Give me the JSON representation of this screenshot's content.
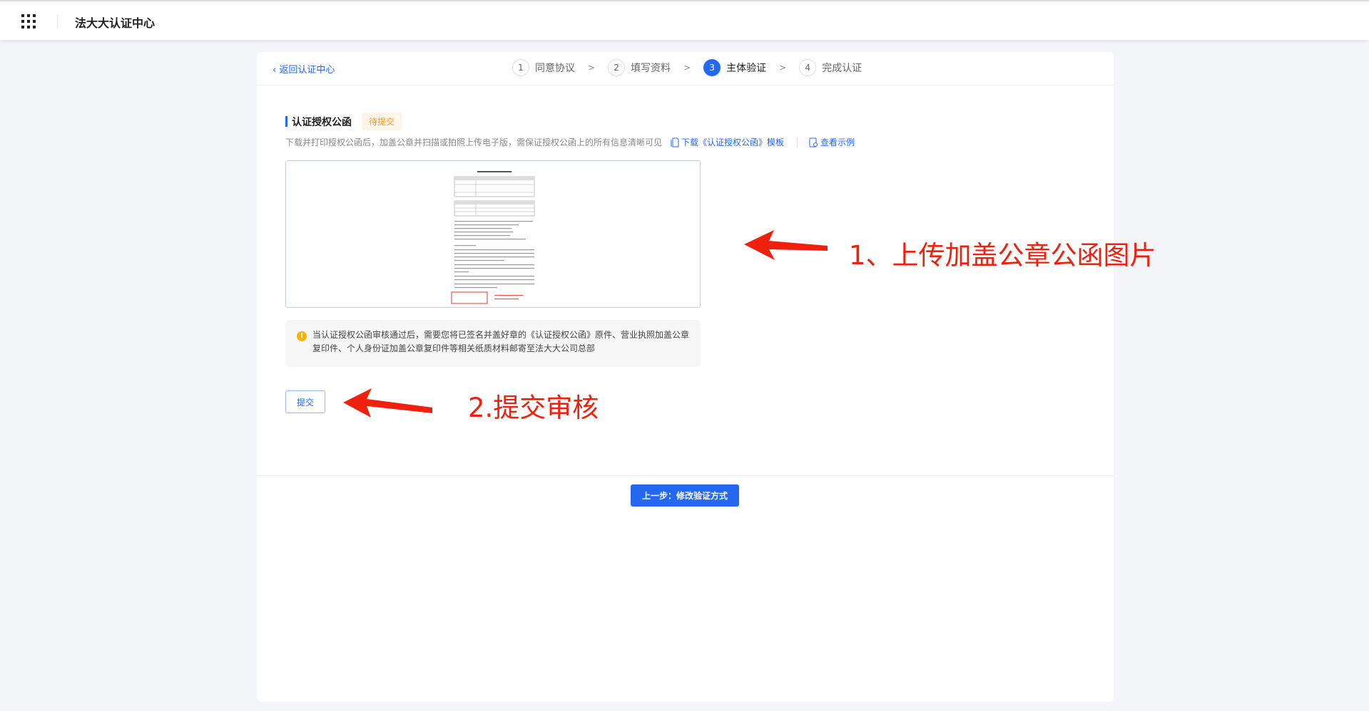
{
  "header": {
    "title": "法大大认证中心",
    "apps_icon": "grid-icon"
  },
  "nav": {
    "back_label": "返回认证中心"
  },
  "steps": [
    {
      "num": "1",
      "label": "同意协议",
      "state": "done"
    },
    {
      "num": "2",
      "label": "填写资料",
      "state": "done"
    },
    {
      "num": "3",
      "label": "主体验证",
      "state": "active"
    },
    {
      "num": "4",
      "label": "完成认证",
      "state": "pending"
    }
  ],
  "section": {
    "title": "认证授权公函",
    "status": "待提交",
    "description": "下载并打印授权公函后，加盖公章并扫描或拍照上传电子版，需保证授权公函上的所有信息清晰可见",
    "download_link": "下载《认证授权公函》模板",
    "example_link": "查看示例"
  },
  "notice": "当认证授权公函审核通过后，需要您将已签名并盖好章的《认证授权公函》原件、营业执照加盖公章复印件、个人身份证加盖公章复印件等相关纸质材料邮寄至法大大公司总部",
  "buttons": {
    "submit": "提交",
    "previous": "上一步：修改验证方式"
  },
  "annotations": {
    "upload": "1、上传加盖公章公函图片",
    "submit": "2.提交审核"
  },
  "colors": {
    "primary": "#2468f2",
    "badge": "#f39a2b",
    "annotation": "#f0200f"
  }
}
